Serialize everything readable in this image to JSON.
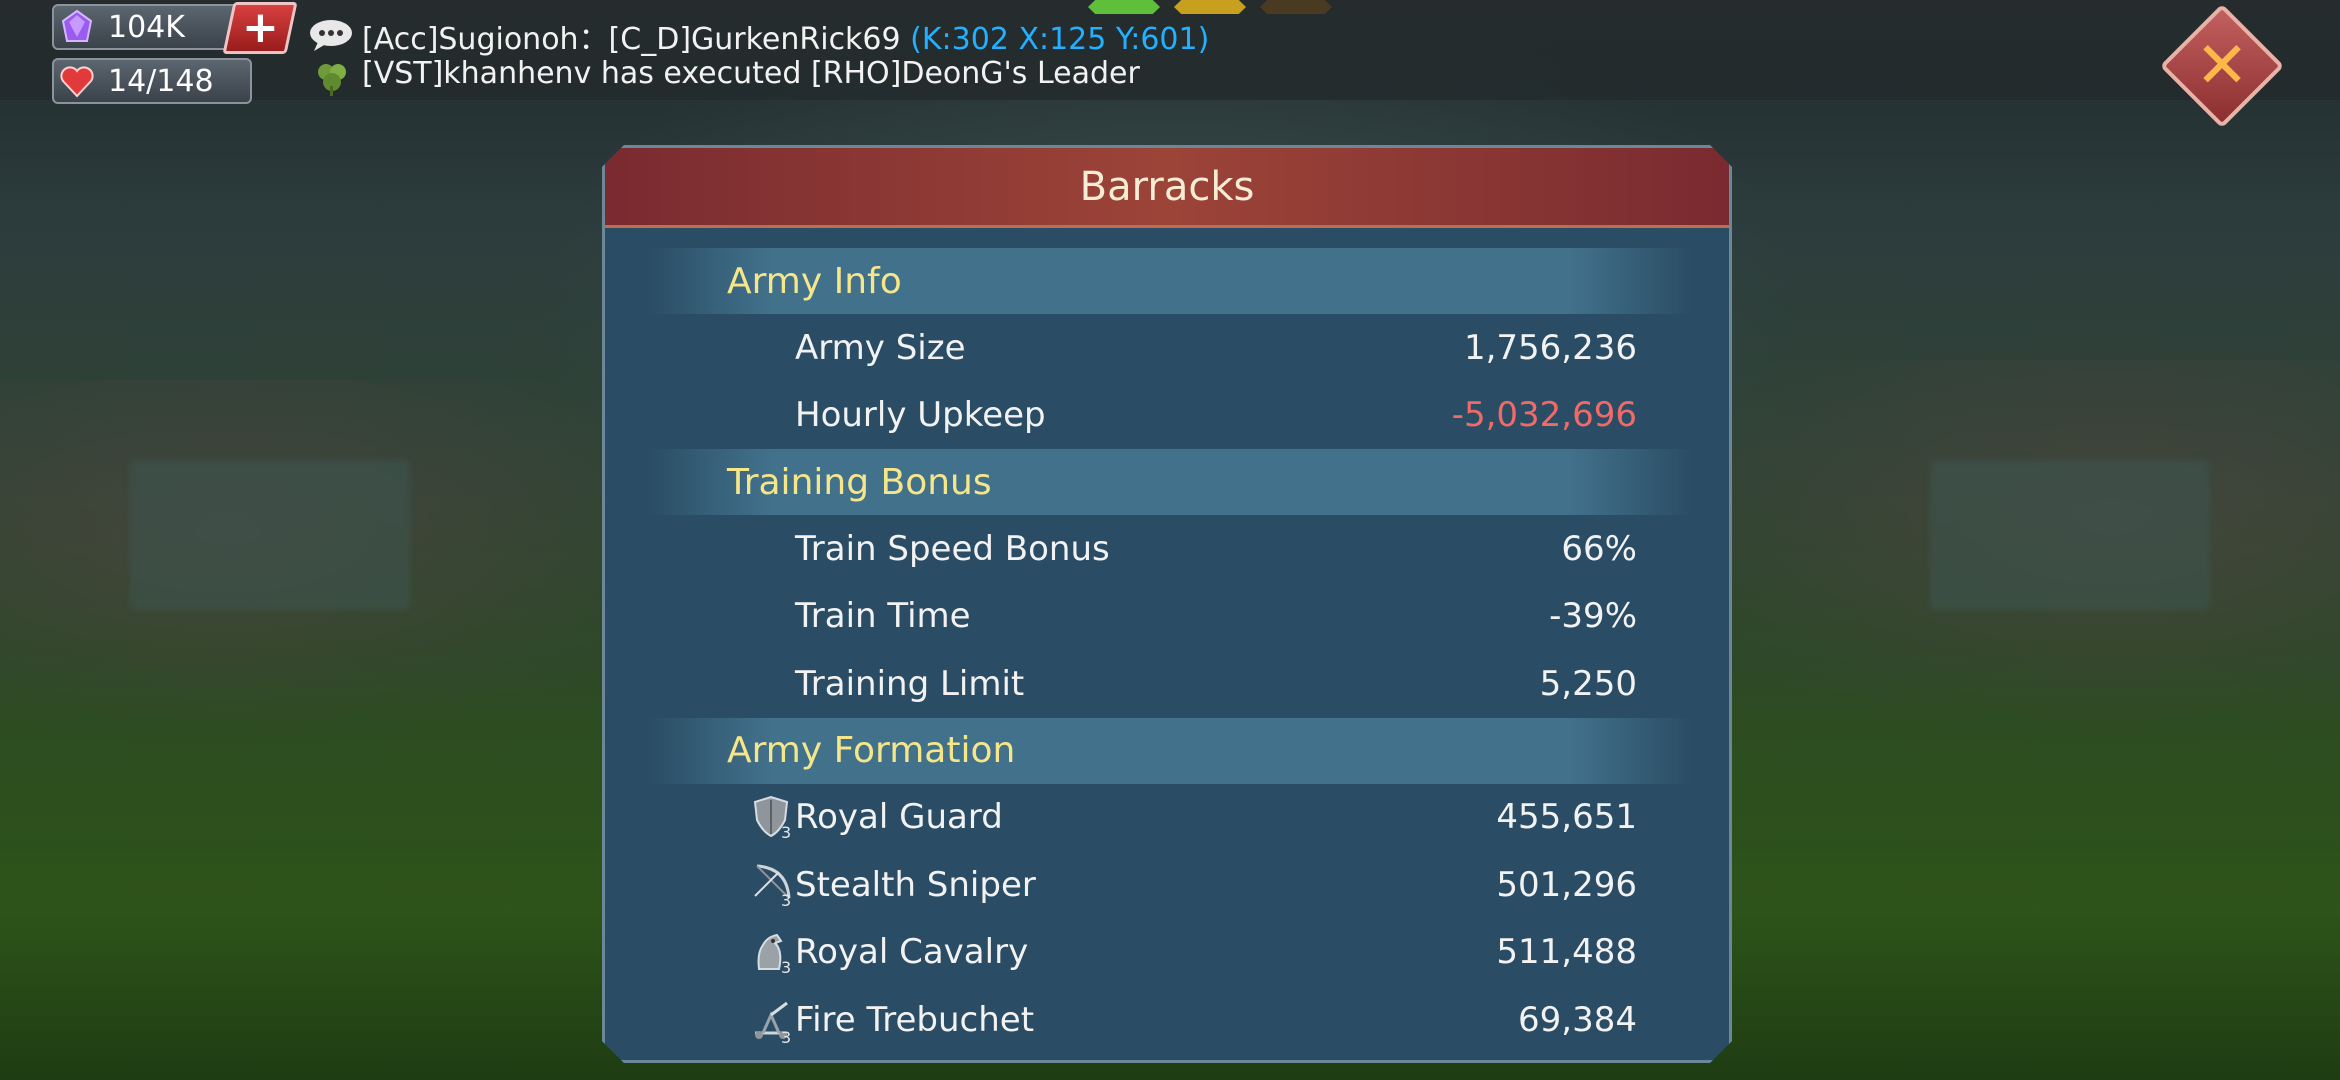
{
  "resources": {
    "gems": "104K",
    "stamina": "14/148",
    "add_label": "+"
  },
  "chat": {
    "line1_text": "[Acc]Sugionoh：[C_D]GurkenRick69",
    "line1_coords": "(K:302 X:125 Y:601)",
    "line2_text": "[VST]khanhenv has executed [RHO]DeonG's Leader"
  },
  "window": {
    "title": "Barracks",
    "close_label": "✕"
  },
  "sections": {
    "army_info": {
      "title": "Army Info",
      "army_size_label": "Army Size",
      "army_size_value": "1,756,236",
      "upkeep_label": "Hourly Upkeep",
      "upkeep_value": "-5,032,696"
    },
    "training_bonus": {
      "title": "Training Bonus",
      "speed_label": "Train Speed Bonus",
      "speed_value": "66%",
      "time_label": "Train Time",
      "time_value": "-39%",
      "limit_label": "Training Limit",
      "limit_value": "5,250"
    },
    "army_formation": {
      "title": "Army Formation",
      "troops": [
        {
          "name": "Royal Guard",
          "value": "455,651",
          "tier": "3",
          "icon": "shield-icon"
        },
        {
          "name": "Stealth Sniper",
          "value": "501,296",
          "tier": "3",
          "icon": "bow-icon"
        },
        {
          "name": "Royal Cavalry",
          "value": "511,488",
          "tier": "3",
          "icon": "horse-icon"
        },
        {
          "name": "Fire Trebuchet",
          "value": "69,384",
          "tier": "3",
          "icon": "trebuchet-icon"
        }
      ]
    }
  },
  "colors": {
    "panel_bg": "#2a4c64",
    "header_red": "#9c4438",
    "section_title": "#f6e68a",
    "negative_value": "#f06a68",
    "coords_blue": "#22b0ff"
  }
}
